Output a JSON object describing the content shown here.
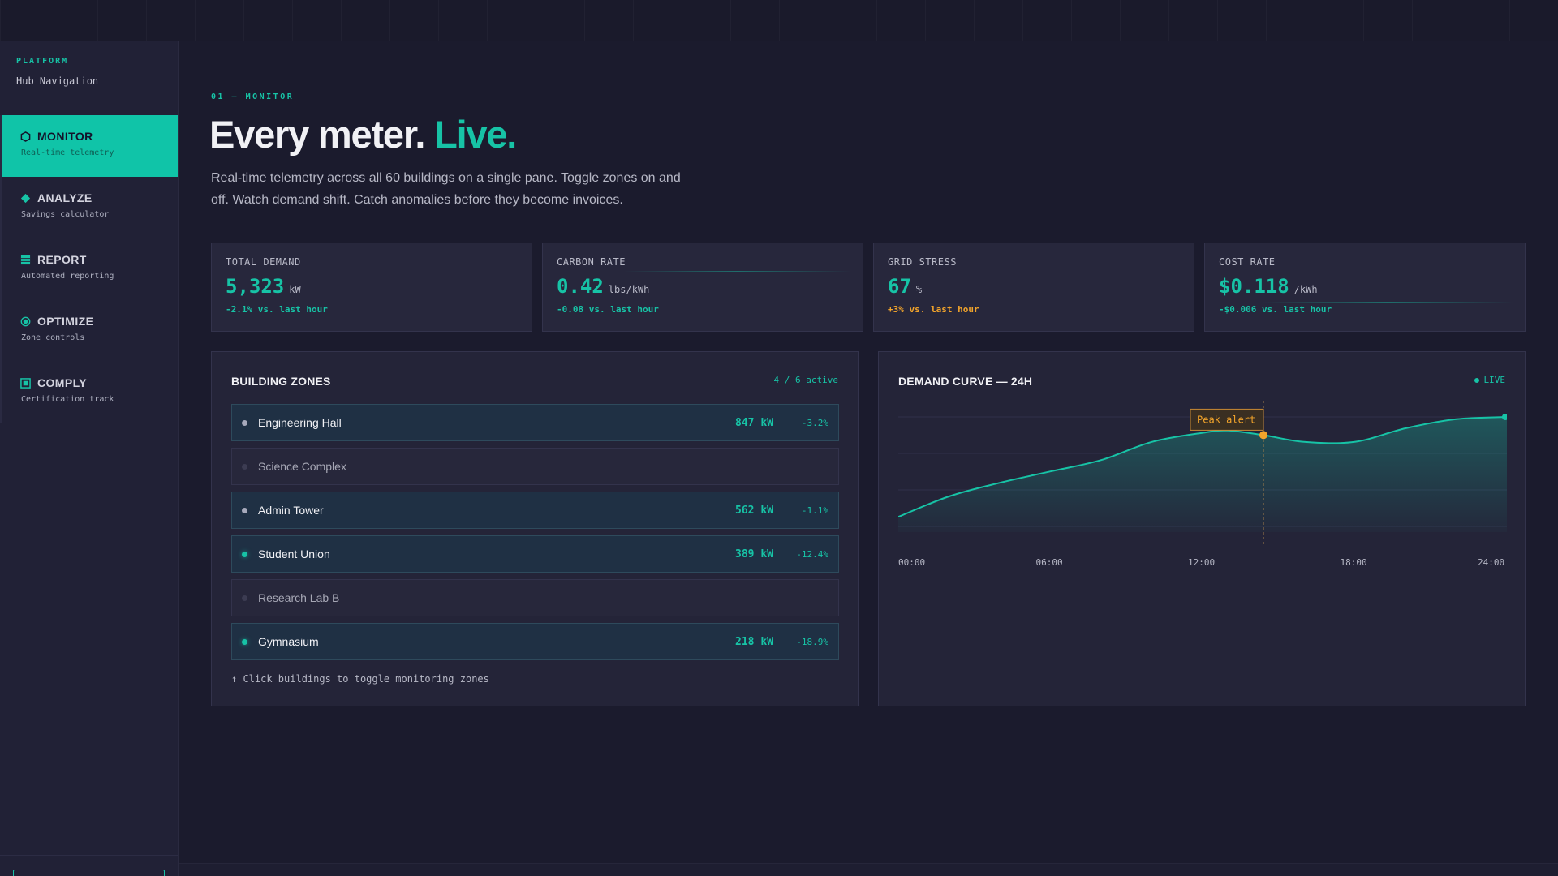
{
  "sidebar": {
    "kicker": "PLATFORM",
    "title": "Hub Navigation",
    "items": [
      {
        "label": "MONITOR",
        "sub": "Real-time telemetry",
        "icon": "hexagon-icon"
      },
      {
        "label": "ANALYZE",
        "sub": "Savings calculator",
        "icon": "diamond-icon"
      },
      {
        "label": "REPORT",
        "sub": "Automated reporting",
        "icon": "grid-square-icon"
      },
      {
        "label": "OPTIMIZE",
        "sub": "Zone controls",
        "icon": "target-icon"
      },
      {
        "label": "COMPLY",
        "sub": "Certification track",
        "icon": "square-check-icon"
      }
    ],
    "active_index": 0
  },
  "header": {
    "kicker": "01 — MONITOR",
    "title_main": "Every meter.",
    "title_accent": "Live.",
    "lead": "Real-time telemetry across all 60 buildings on a single pane. Toggle zones on and off. Watch demand shift. Catch anomalies before they become invoices."
  },
  "stats": [
    {
      "label": "TOTAL DEMAND",
      "value": "5,323",
      "unit": "kW",
      "delta": "-2.1% vs. last hour",
      "status": "good"
    },
    {
      "label": "CARBON RATE",
      "value": "0.42",
      "unit": "lbs/kWh",
      "delta": "-0.08 vs. last hour",
      "status": "good"
    },
    {
      "label": "GRID STRESS",
      "value": "67",
      "unit": "%",
      "delta": "+3% vs. last hour",
      "status": "warn"
    },
    {
      "label": "COST RATE",
      "value": "$0.118",
      "unit": "/kWh",
      "delta": "-$0.006 vs. last hour",
      "status": "good"
    }
  ],
  "zones_panel": {
    "title": "BUILDING ZONES",
    "active_count": "4 / 6 active",
    "hint": "↑ Click buildings to toggle monitoring zones",
    "zones": [
      {
        "name": "Engineering Hall",
        "active": true,
        "dot": "gray",
        "kw": "847 kW",
        "change": "-3.2%"
      },
      {
        "name": "Science Complex",
        "active": false,
        "dot": "off",
        "kw": "",
        "change": ""
      },
      {
        "name": "Admin Tower",
        "active": true,
        "dot": "gray",
        "kw": "562 kW",
        "change": "-1.1%"
      },
      {
        "name": "Student Union",
        "active": true,
        "dot": "teal",
        "kw": "389 kW",
        "change": "-12.4%"
      },
      {
        "name": "Research Lab B",
        "active": false,
        "dot": "off",
        "kw": "",
        "change": ""
      },
      {
        "name": "Gymnasium",
        "active": true,
        "dot": "teal",
        "kw": "218 kW",
        "change": "-18.9%"
      }
    ]
  },
  "curve_panel": {
    "title": "DEMAND CURVE — 24H",
    "live_label": "LIVE",
    "peak_label": "Peak alert",
    "colors": {
      "line": "#17c3a6",
      "peak": "#f2a42b"
    }
  },
  "chart_data": {
    "type": "area",
    "x_ticks": [
      "00:00",
      "06:00",
      "12:00",
      "18:00",
      "24:00"
    ],
    "x": [
      0,
      2,
      4,
      6,
      8,
      10,
      12,
      13,
      14.4,
      16,
      18,
      20,
      22,
      24
    ],
    "values": [
      0.12,
      0.3,
      0.42,
      0.52,
      0.62,
      0.78,
      0.86,
      0.88,
      0.84,
      0.78,
      0.78,
      0.9,
      0.98,
      1.0
    ],
    "peak_x": 14.4,
    "grid": true,
    "legend": "none"
  }
}
